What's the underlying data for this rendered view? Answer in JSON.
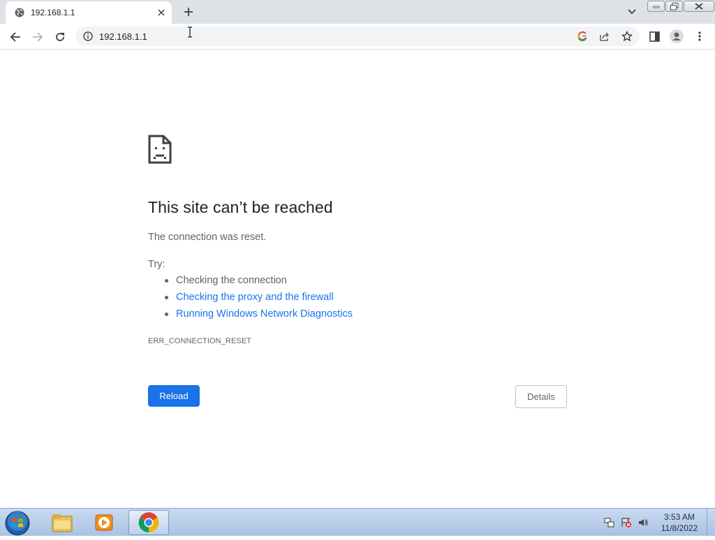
{
  "tab": {
    "title": "192.168.1.1",
    "favicon": "globe-icon"
  },
  "toolbar": {
    "url": "192.168.1.1",
    "icons": [
      "back-icon",
      "forward-icon",
      "reload-icon",
      "info-icon",
      "google-lens-icon",
      "share-icon",
      "bookmark-star-icon",
      "side-panel-icon",
      "profile-icon",
      "menu-icon"
    ]
  },
  "error_page": {
    "title": "This site can’t be reached",
    "description": "The connection was reset.",
    "try_label": "Try:",
    "suggestions": [
      {
        "text": "Checking the connection",
        "is_link": false
      },
      {
        "text": "Checking the proxy and the firewall",
        "is_link": true
      },
      {
        "text": "Running Windows Network Diagnostics",
        "is_link": true
      }
    ],
    "error_code": "ERR_CONNECTION_RESET",
    "reload_label": "Reload",
    "details_label": "Details"
  },
  "taskbar": {
    "apps": [
      "explorer",
      "media-player",
      "chrome"
    ],
    "time": "3:53 AM",
    "date": "11/8/2022"
  },
  "colors": {
    "accent": "#1a73e8",
    "text_primary": "#202124",
    "text_secondary": "#5f6368",
    "tabstrip_bg": "#dee1e6"
  }
}
